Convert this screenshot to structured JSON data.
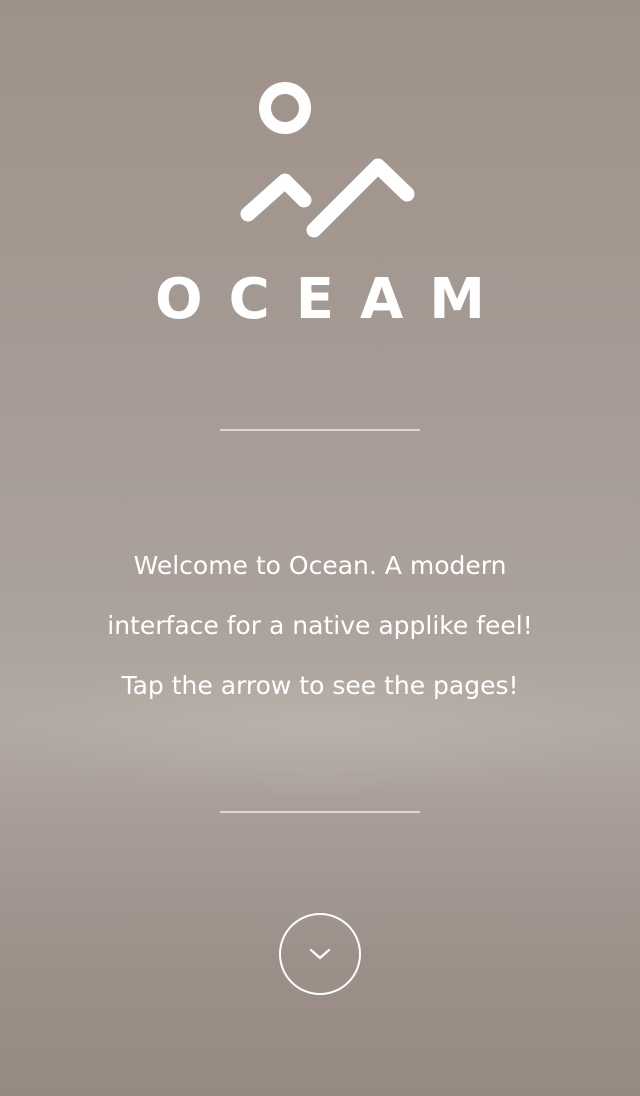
{
  "brand": {
    "logo_icon": "sun-mountains-icon",
    "name": "OCEAM"
  },
  "intro": {
    "lines": [
      "Welcome to Ocean. A modern",
      "interface for a native applike feel!",
      "Tap the arrow to see the pages!"
    ]
  },
  "nav": {
    "arrow_icon": "chevron-down-icon"
  },
  "colors": {
    "text": "#ffffff",
    "background": "#a59a93"
  }
}
